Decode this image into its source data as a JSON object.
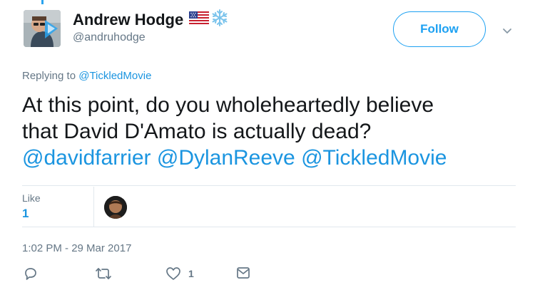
{
  "header": {
    "display_name": "Andrew Hodge",
    "handle": "@andruhodge",
    "follow_label": "Follow",
    "name_icons": [
      "us-flag-icon",
      "snowflake-icon"
    ]
  },
  "replying": {
    "prefix": "Replying to",
    "mention": "@TickledMovie"
  },
  "tweet": {
    "line1": "At this point, do you wholeheartedly believe",
    "line2": "that David D'Amato is actually dead?",
    "mentions": [
      "@davidfarrier",
      "@DylanReeve",
      "@TickledMovie"
    ]
  },
  "stats": {
    "like_label": "Like",
    "like_count": "1"
  },
  "timestamp": "1:02 PM - 29 Mar 2017",
  "actions": {
    "reply_icon": "reply-icon",
    "retweet_icon": "retweet-icon",
    "like_icon": "heart-icon",
    "like_count": "1",
    "dm_icon": "envelope-icon"
  },
  "colors": {
    "accent": "#1da1f2",
    "link": "#1b95e0",
    "muted": "#657786",
    "text": "#14171a",
    "divider": "#e1e8ed"
  }
}
